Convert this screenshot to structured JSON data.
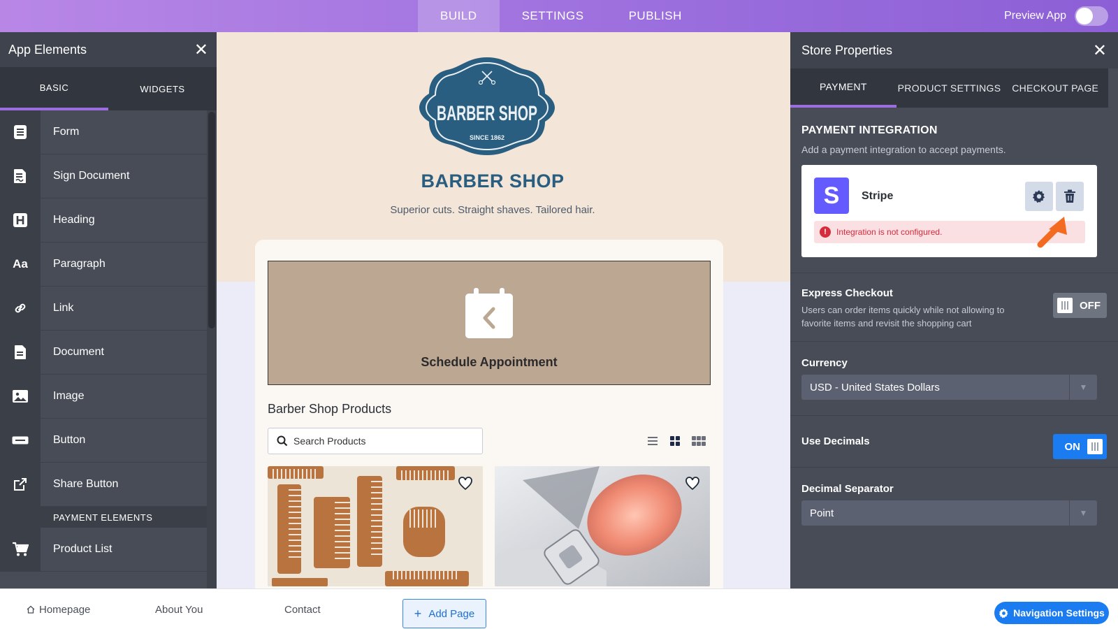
{
  "topbar": {
    "tabs": [
      {
        "label": "BUILD",
        "active": true
      },
      {
        "label": "SETTINGS",
        "active": false
      },
      {
        "label": "PUBLISH",
        "active": false
      }
    ],
    "preview_label": "Preview App",
    "preview_on": false
  },
  "left_panel": {
    "title": "App Elements",
    "tabs": [
      {
        "label": "BASIC"
      },
      {
        "label": "WIDGETS"
      }
    ],
    "items": [
      {
        "label": "Form",
        "icon": "form-icon"
      },
      {
        "label": "Sign Document",
        "icon": "sign-document-icon"
      },
      {
        "label": "Heading",
        "icon": "heading-icon"
      },
      {
        "label": "Paragraph",
        "icon": "paragraph-icon"
      },
      {
        "label": "Link",
        "icon": "link-icon"
      },
      {
        "label": "Document",
        "icon": "document-icon"
      },
      {
        "label": "Image",
        "icon": "image-icon"
      },
      {
        "label": "Button",
        "icon": "button-icon"
      },
      {
        "label": "Share Button",
        "icon": "share-icon"
      }
    ],
    "section_label": "PAYMENT ELEMENTS",
    "payment_items": [
      {
        "label": "Product List",
        "icon": "cart-icon"
      }
    ]
  },
  "canvas": {
    "logo": {
      "main": "BARBER SHOP",
      "since": "SINCE 1862"
    },
    "title": "BARBER SHOP",
    "tagline": "Superior cuts. Straight shaves. Tailored hair.",
    "appointment_label": "Schedule Appointment",
    "products_heading": "Barber Shop Products",
    "search_placeholder": "Search Products"
  },
  "right_panel": {
    "title": "Store Properties",
    "tabs": [
      {
        "label": "PAYMENT",
        "active": true
      },
      {
        "label": "PRODUCT SETTINGS",
        "active": false
      },
      {
        "label": "CHECKOUT PAGE",
        "active": false
      }
    ],
    "payment_integration": {
      "title": "PAYMENT INTEGRATION",
      "description": "Add a payment integration to accept payments.",
      "provider": "Stripe",
      "provider_letter": "S",
      "error": "Integration is not configured."
    },
    "express_checkout": {
      "title": "Express Checkout",
      "description": "Users can order items quickly while not allowing to favorite items and revisit the shopping cart",
      "state": "OFF"
    },
    "currency": {
      "title": "Currency",
      "value": "USD - United States Dollars"
    },
    "use_decimals": {
      "title": "Use Decimals",
      "state": "ON"
    },
    "decimal_separator": {
      "title": "Decimal Separator",
      "value": "Point"
    }
  },
  "bottombar": {
    "pages": [
      {
        "label": "Homepage"
      },
      {
        "label": "About You"
      },
      {
        "label": "Contact"
      }
    ],
    "add_page_label": "Add Page",
    "nav_settings_label": "Navigation Settings"
  },
  "colors": {
    "topbar_gradient": [
      "#b887e6",
      "#8c5fd6"
    ],
    "accent_purple": "#9b6de0",
    "stripe": "#635bff",
    "toggle_on": "#1a7cf0",
    "error": "#d52b3c",
    "arrow": "#f26b21",
    "brand_blue": "#2a5e80"
  }
}
